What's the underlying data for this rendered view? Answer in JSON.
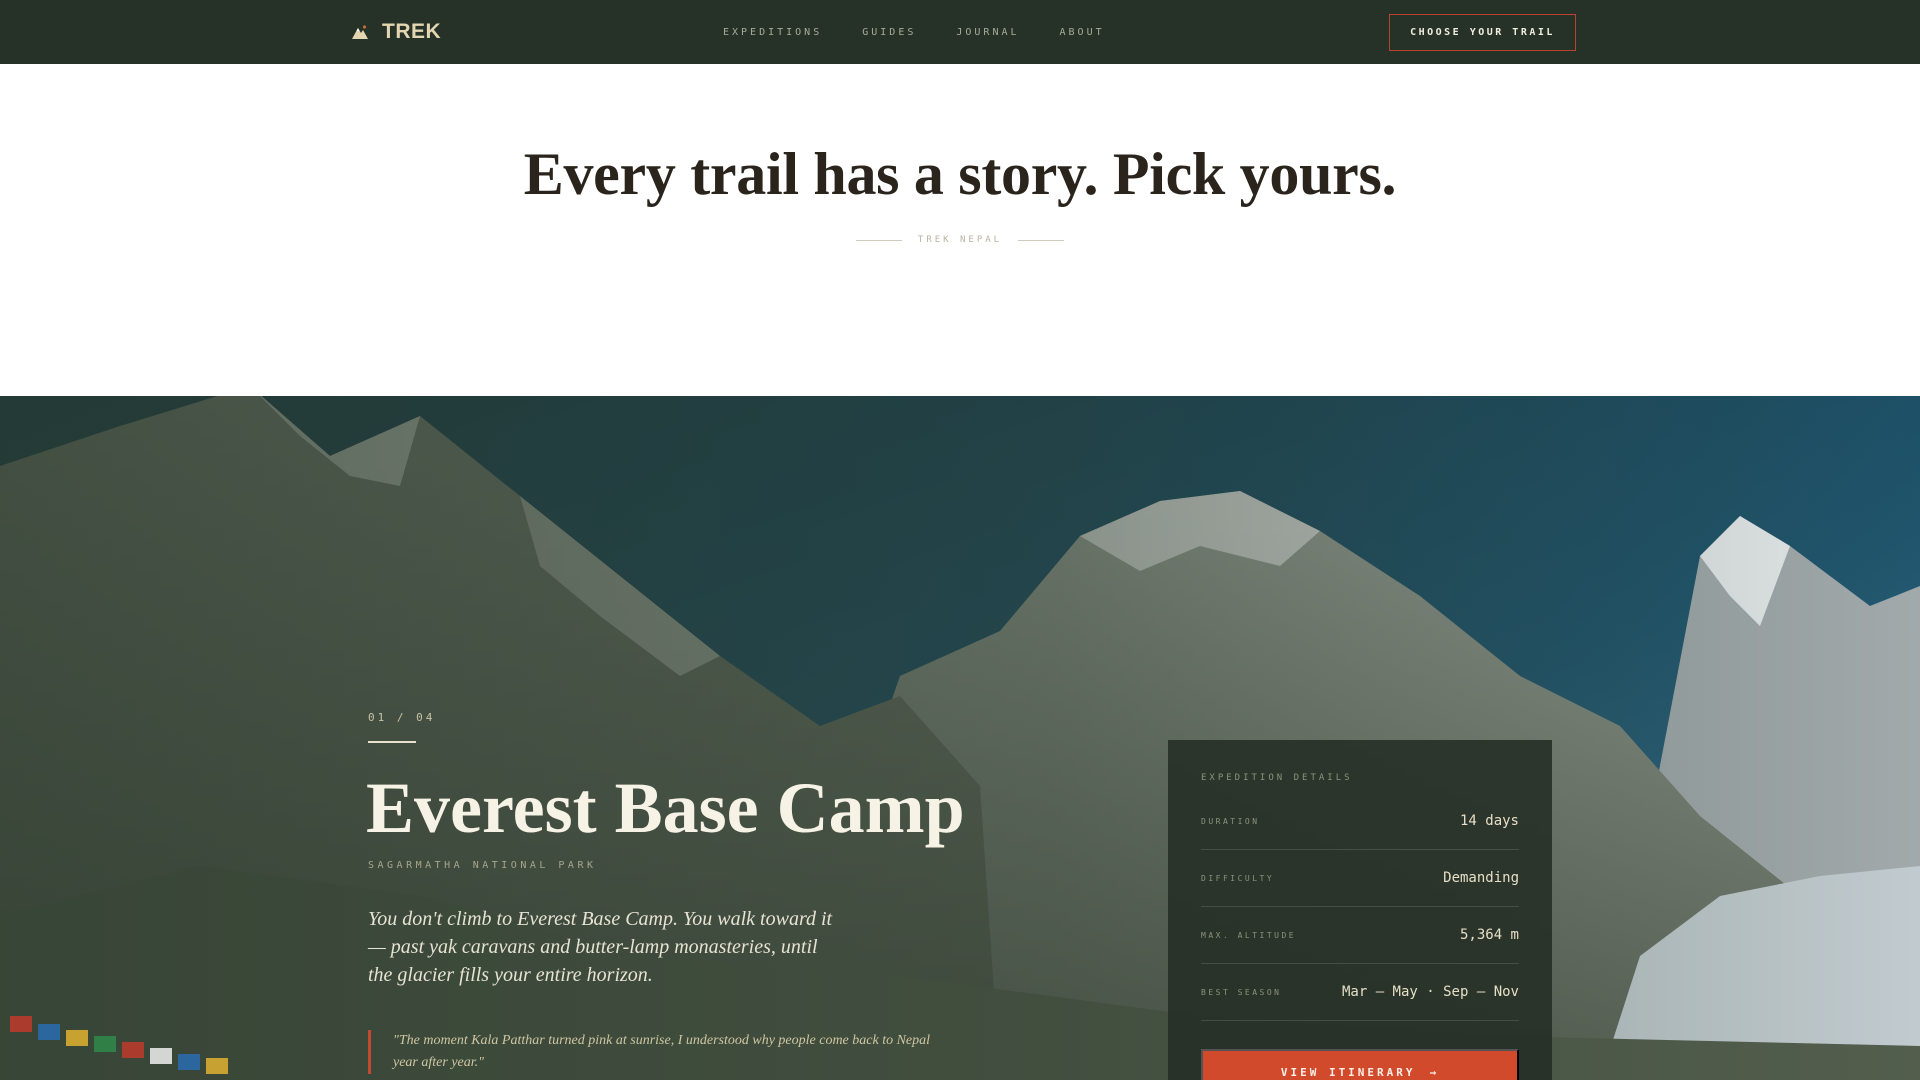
{
  "nav": {
    "brand": "TREK",
    "brand_icon": "mountain-icon",
    "links": [
      "EXPEDITIONS",
      "GUIDES",
      "JOURNAL",
      "ABOUT"
    ],
    "cta": "CHOOSE YOUR TRAIL"
  },
  "hero": {
    "title": "Every trail has a story. Pick yours.",
    "tag": "TREK NEPAL"
  },
  "feature": {
    "counter": "01 / 04",
    "title": "Everest Base Camp",
    "subtitle": "SAGARMATHA NATIONAL PARK",
    "description": "You don't climb to Everest Base Camp. You walk toward it — past yak caravans and butter-lamp monasteries, until the glacier fills your entire horizon.",
    "quote": "\"The moment Kala Patthar turned pink at sunrise, I understood why people come back to Nepal year after year.\""
  },
  "details": {
    "heading": "EXPEDITION DETAILS",
    "rows": [
      {
        "label": "DURATION",
        "value": "14 days"
      },
      {
        "label": "DIFFICULTY",
        "value": "Demanding"
      },
      {
        "label": "MAX. ALTITUDE",
        "value": "5,364 m"
      },
      {
        "label": "BEST SEASON",
        "value": "Mar – May · Sep – Nov"
      }
    ],
    "button": "VIEW ITINERARY",
    "button_icon": "arrow-right-icon"
  },
  "colors": {
    "nav_bg": "#263127",
    "accent": "#d04a2b",
    "brand_text": "#e4d6b0"
  }
}
